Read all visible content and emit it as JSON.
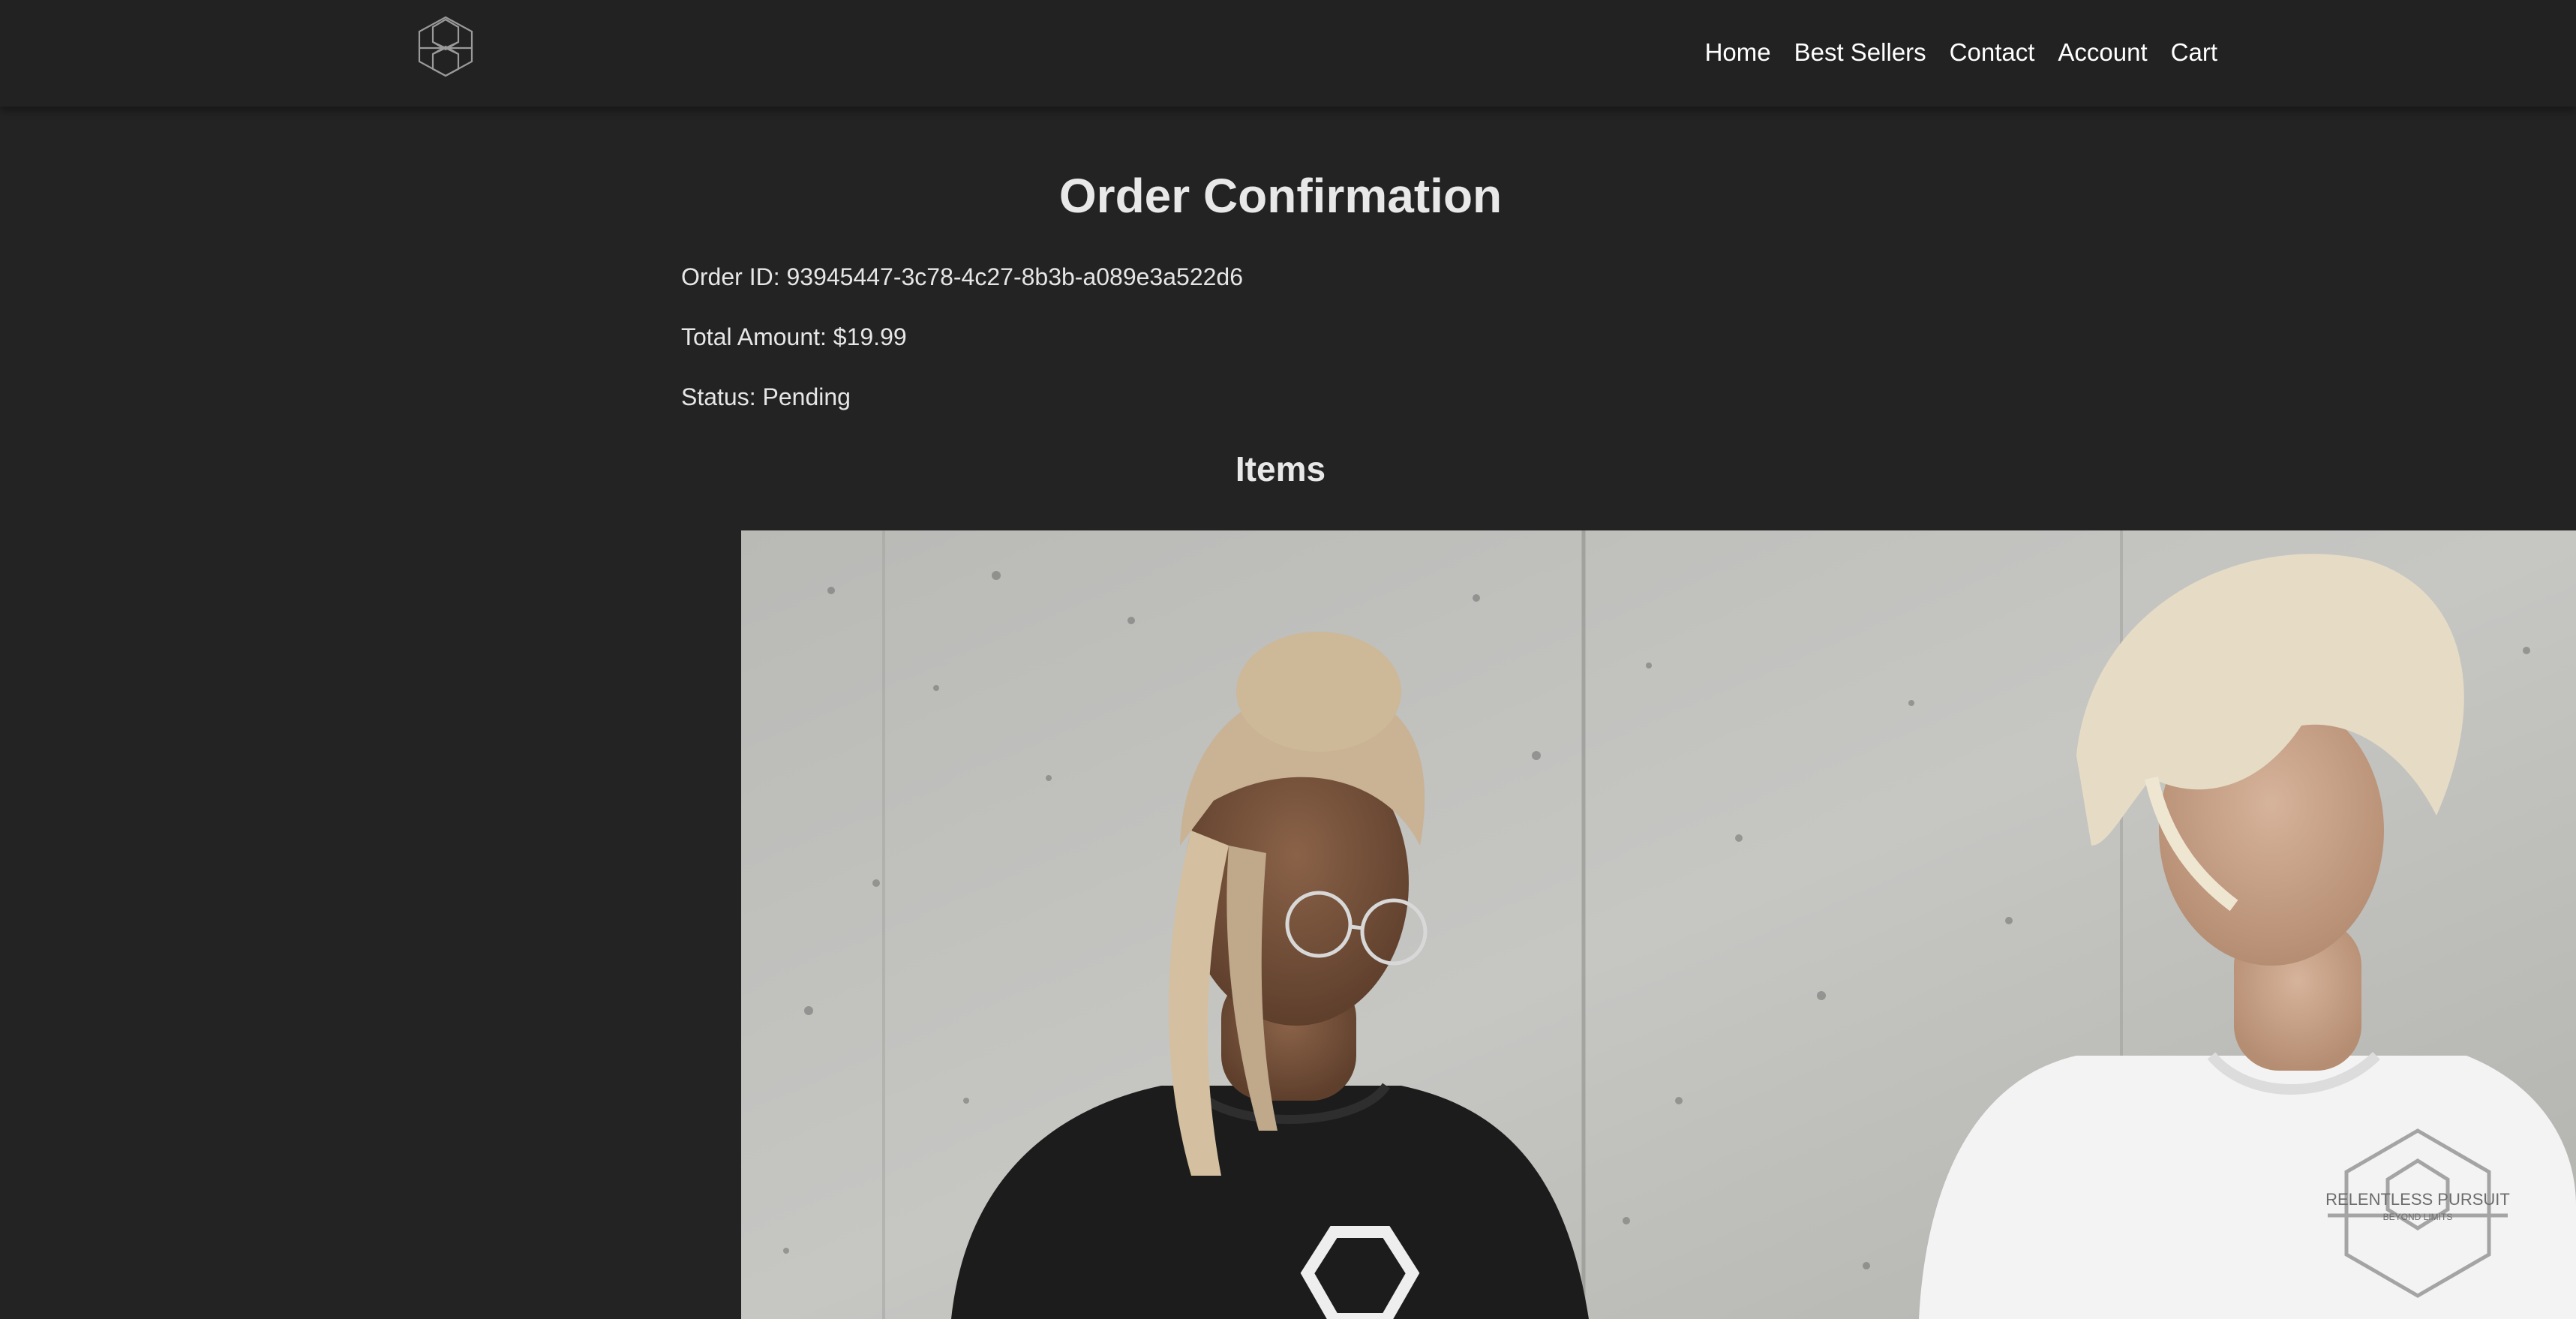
{
  "header": {
    "logo_icon": "hexagon-cube-logo",
    "nav": [
      "Home",
      "Best Sellers",
      "Contact",
      "Account",
      "Cart"
    ]
  },
  "order": {
    "title": "Order Confirmation",
    "id_line": "Order ID: 93945447-3c78-4c27-8b3b-a089e3a522d6",
    "total_line": "Total Amount: $19.99",
    "status_line": "Status: Pending"
  },
  "items": {
    "heading": "Items",
    "product_image": {
      "description_icon": "product-photo",
      "logo_text": "RELENTLESS PURSUIT",
      "logo_subtext": "BEYOND LIMITS"
    }
  },
  "colors": {
    "background": "#232323",
    "header": "#222222",
    "text": "#e6e6e6"
  }
}
